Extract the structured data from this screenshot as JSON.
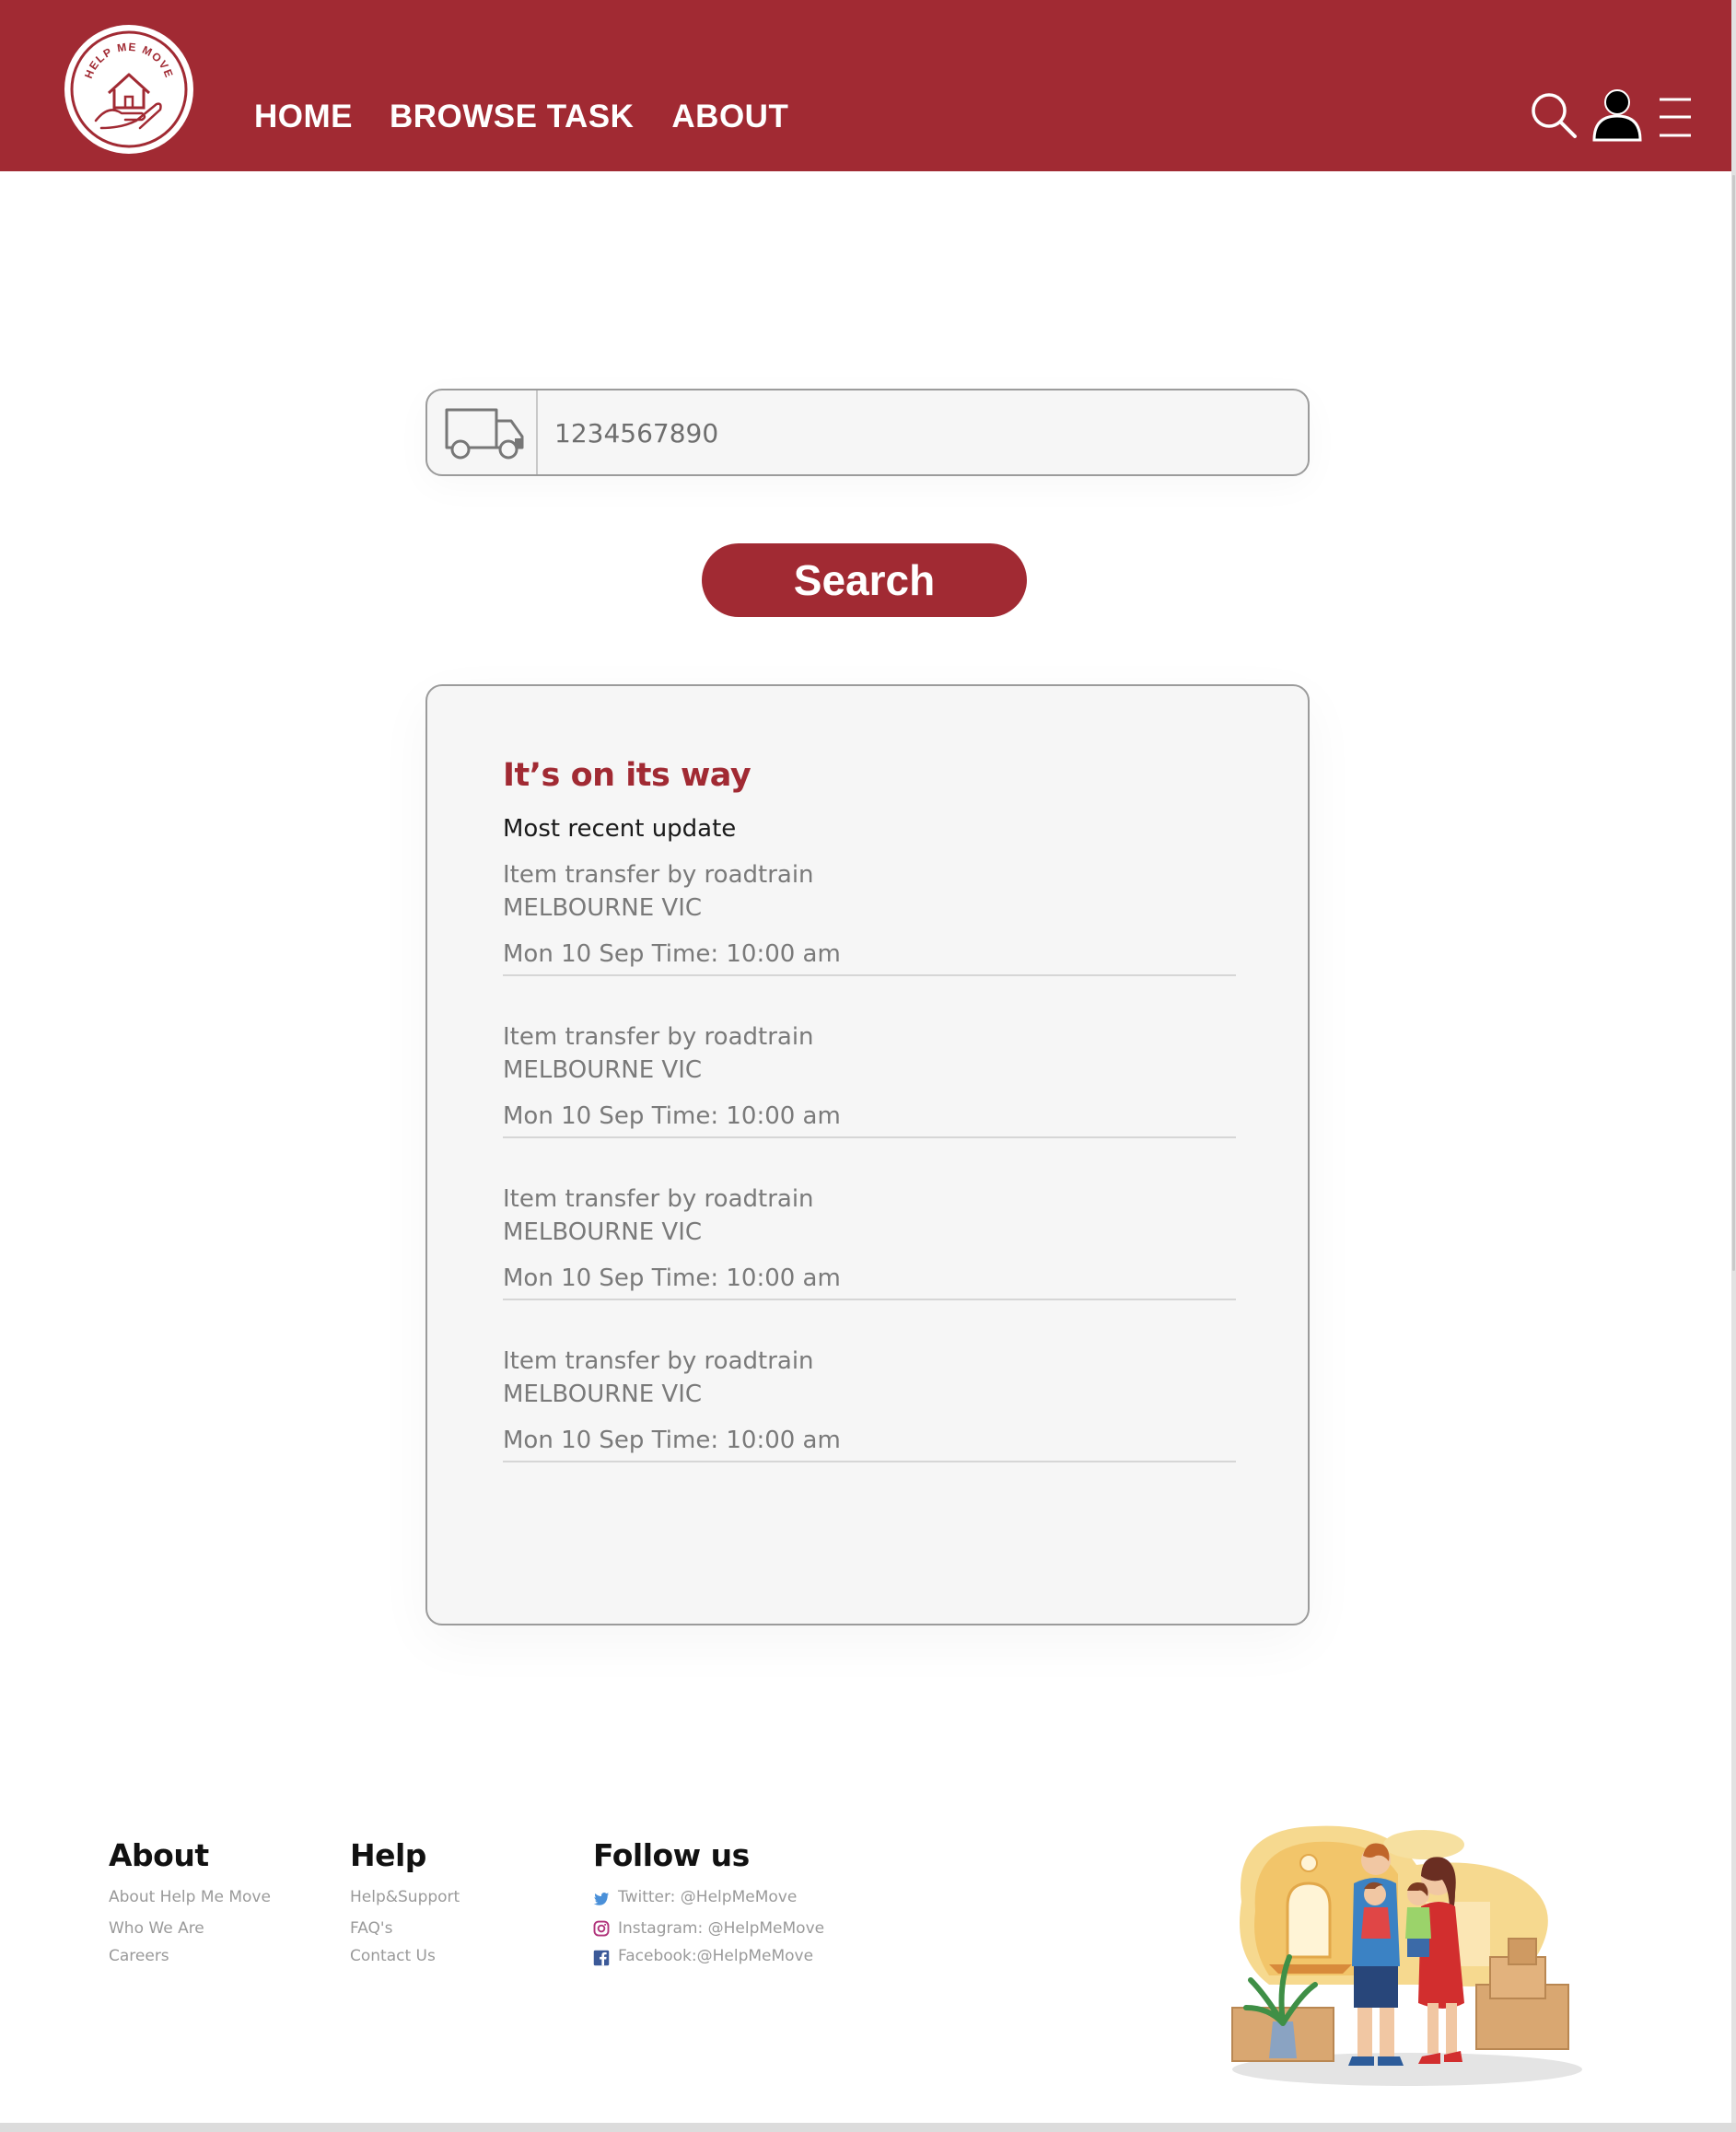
{
  "brand": {
    "logo_text": "HELP ME MOVE",
    "primary_color": "#a12a33"
  },
  "nav": {
    "items": [
      {
        "label": "HOME"
      },
      {
        "label": "BROWSE TASK"
      },
      {
        "label": "ABOUT"
      }
    ],
    "icons": [
      "search-icon",
      "user-icon",
      "hamburger-menu-icon"
    ]
  },
  "tracking": {
    "input_value": "1234567890",
    "search_label": "Search"
  },
  "results": {
    "title": "It’s on its way",
    "subtitle": "Most recent update",
    "updates": [
      {
        "description": "Item transfer by roadtrain",
        "location": "MELBOURNE VIC",
        "datetime": "Mon 10 Sep  Time: 10:00 am"
      },
      {
        "description": "Item transfer by roadtrain",
        "location": "MELBOURNE VIC",
        "datetime": "Mon 10 Sep  Time: 10:00 am"
      },
      {
        "description": "Item transfer by roadtrain",
        "location": "MELBOURNE VIC",
        "datetime": "Mon 10 Sep  Time: 10:00 am"
      },
      {
        "description": "Item transfer by roadtrain",
        "location": "MELBOURNE VIC",
        "datetime": "Mon 10 Sep  Time: 10:00 am"
      }
    ]
  },
  "footer": {
    "about": {
      "heading": "About",
      "links": [
        "About Help Me Move",
        "Who We Are",
        "Careers"
      ]
    },
    "help": {
      "heading": "Help",
      "links": [
        "Help&Support",
        "FAQ's",
        "Contact Us"
      ]
    },
    "follow": {
      "heading": "Follow us",
      "links": [
        {
          "icon": "twitter-icon",
          "label": "Twitter: @HelpMeMove"
        },
        {
          "icon": "instagram-icon",
          "label": "Instagram: @HelpMeMove"
        },
        {
          "icon": "facebook-icon",
          "label": "Facebook:@HelpMeMove"
        }
      ]
    }
  }
}
